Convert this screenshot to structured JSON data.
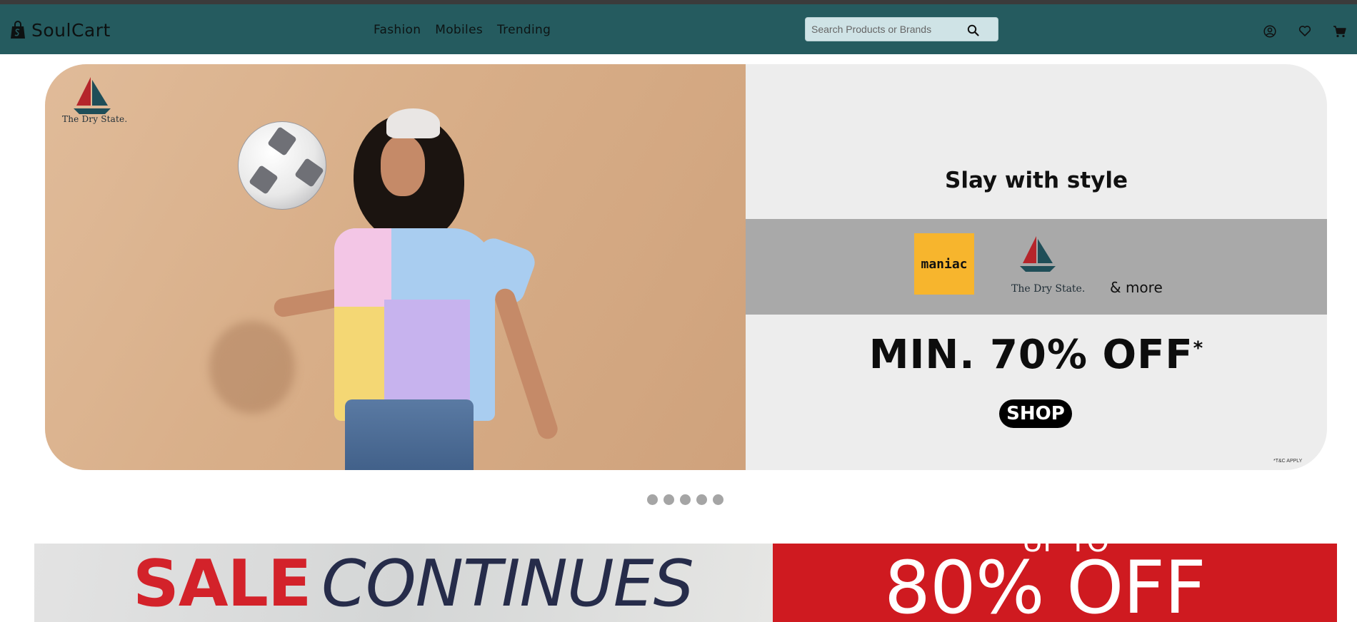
{
  "header": {
    "brand_name": "SoulCart",
    "brand_icon": "shopping-bag-icon",
    "nav_links": [
      {
        "label": "Fashion"
      },
      {
        "label": "Mobiles"
      },
      {
        "label": "Trending"
      }
    ],
    "search": {
      "placeholder": "Search Products or Brands",
      "value": ""
    },
    "icons": [
      "user-icon",
      "heart-icon",
      "cart-icon"
    ]
  },
  "hero_banner": {
    "logo_text": "The Dry State.",
    "title": "Slay with style",
    "brands": [
      "maniac",
      "The Dry State."
    ],
    "and_more": "& more",
    "discount": "MIN. 70% OFF",
    "discount_mark": "*",
    "shop_label": "SHOP",
    "tnc": "*T&C APPLY"
  },
  "carousel": {
    "dots": 5
  },
  "sale_banner": {
    "word1": "SALE",
    "word2": "CONTINUES",
    "upto": "UP TO",
    "offer": "80% OFF"
  },
  "colors": {
    "nav_bg": "#255b5f",
    "sale_red": "#cf1a20",
    "maniac_yellow": "#f7b52d"
  }
}
